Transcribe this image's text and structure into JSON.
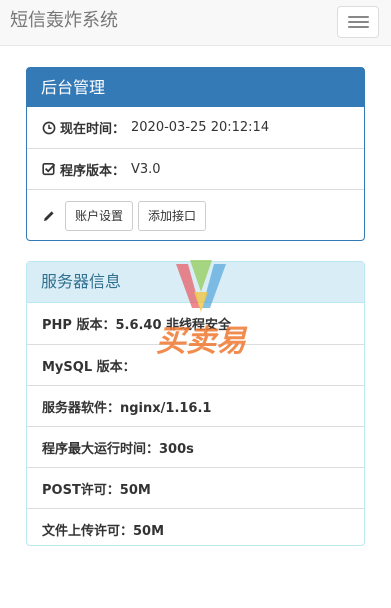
{
  "navbar": {
    "brand": "短信轰炸系统",
    "toggle_icon": "hamburger-menu-icon"
  },
  "admin_panel": {
    "title": "后台管理",
    "current_time_label": "现在时间：",
    "current_time_value": "2020-03-25 20:12:14",
    "version_label": "程序版本：",
    "version_value": "V3.0",
    "account_settings_button": "账户设置",
    "add_interface_button": "添加接口"
  },
  "server_panel": {
    "title": "服务器信息",
    "items": [
      "PHP 版本：5.6.40 非线程安全",
      "MySQL 版本：",
      "服务器软件：nginx/1.16.1",
      "程序最大运行时间：300s",
      "POST许可：50M",
      "文件上传许可：50M"
    ]
  },
  "watermark": {
    "text": "买卖易"
  },
  "colors": {
    "primary": "#337ab7",
    "info_bg": "#d9edf7",
    "info_text": "#31708f",
    "watermark": "#f07830"
  }
}
